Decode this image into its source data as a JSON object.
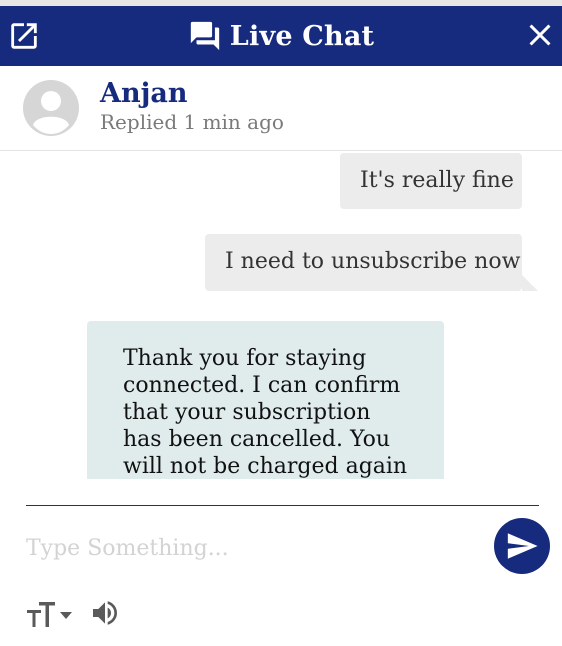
{
  "header": {
    "title": "Live Chat",
    "popout_icon": "external-link-icon",
    "chat_icon": "chat-bubbles-icon",
    "close_icon": "close-icon",
    "background": "#172b7e"
  },
  "agent": {
    "name": "Anjan",
    "status": "Replied 1 min ago",
    "avatar_icon": "person-avatar-icon"
  },
  "messages": [
    {
      "from": "user",
      "text": "It's really fine"
    },
    {
      "from": "user",
      "text": "I need to unsubscribe now"
    },
    {
      "from": "agent",
      "text": "Thank you for staying connected. I can confirm that your subscription has been cancelled. You will not be charged again and"
    }
  ],
  "composer": {
    "placeholder": "Type Something...",
    "value": "",
    "send_icon": "send-icon"
  },
  "toolbar": {
    "text_size_icon": "text-size-icon",
    "volume_icon": "volume-icon"
  },
  "colors": {
    "accent": "#172b7e",
    "outgoing_bubble": "#ececec",
    "incoming_bubble": "#e0ecec"
  }
}
